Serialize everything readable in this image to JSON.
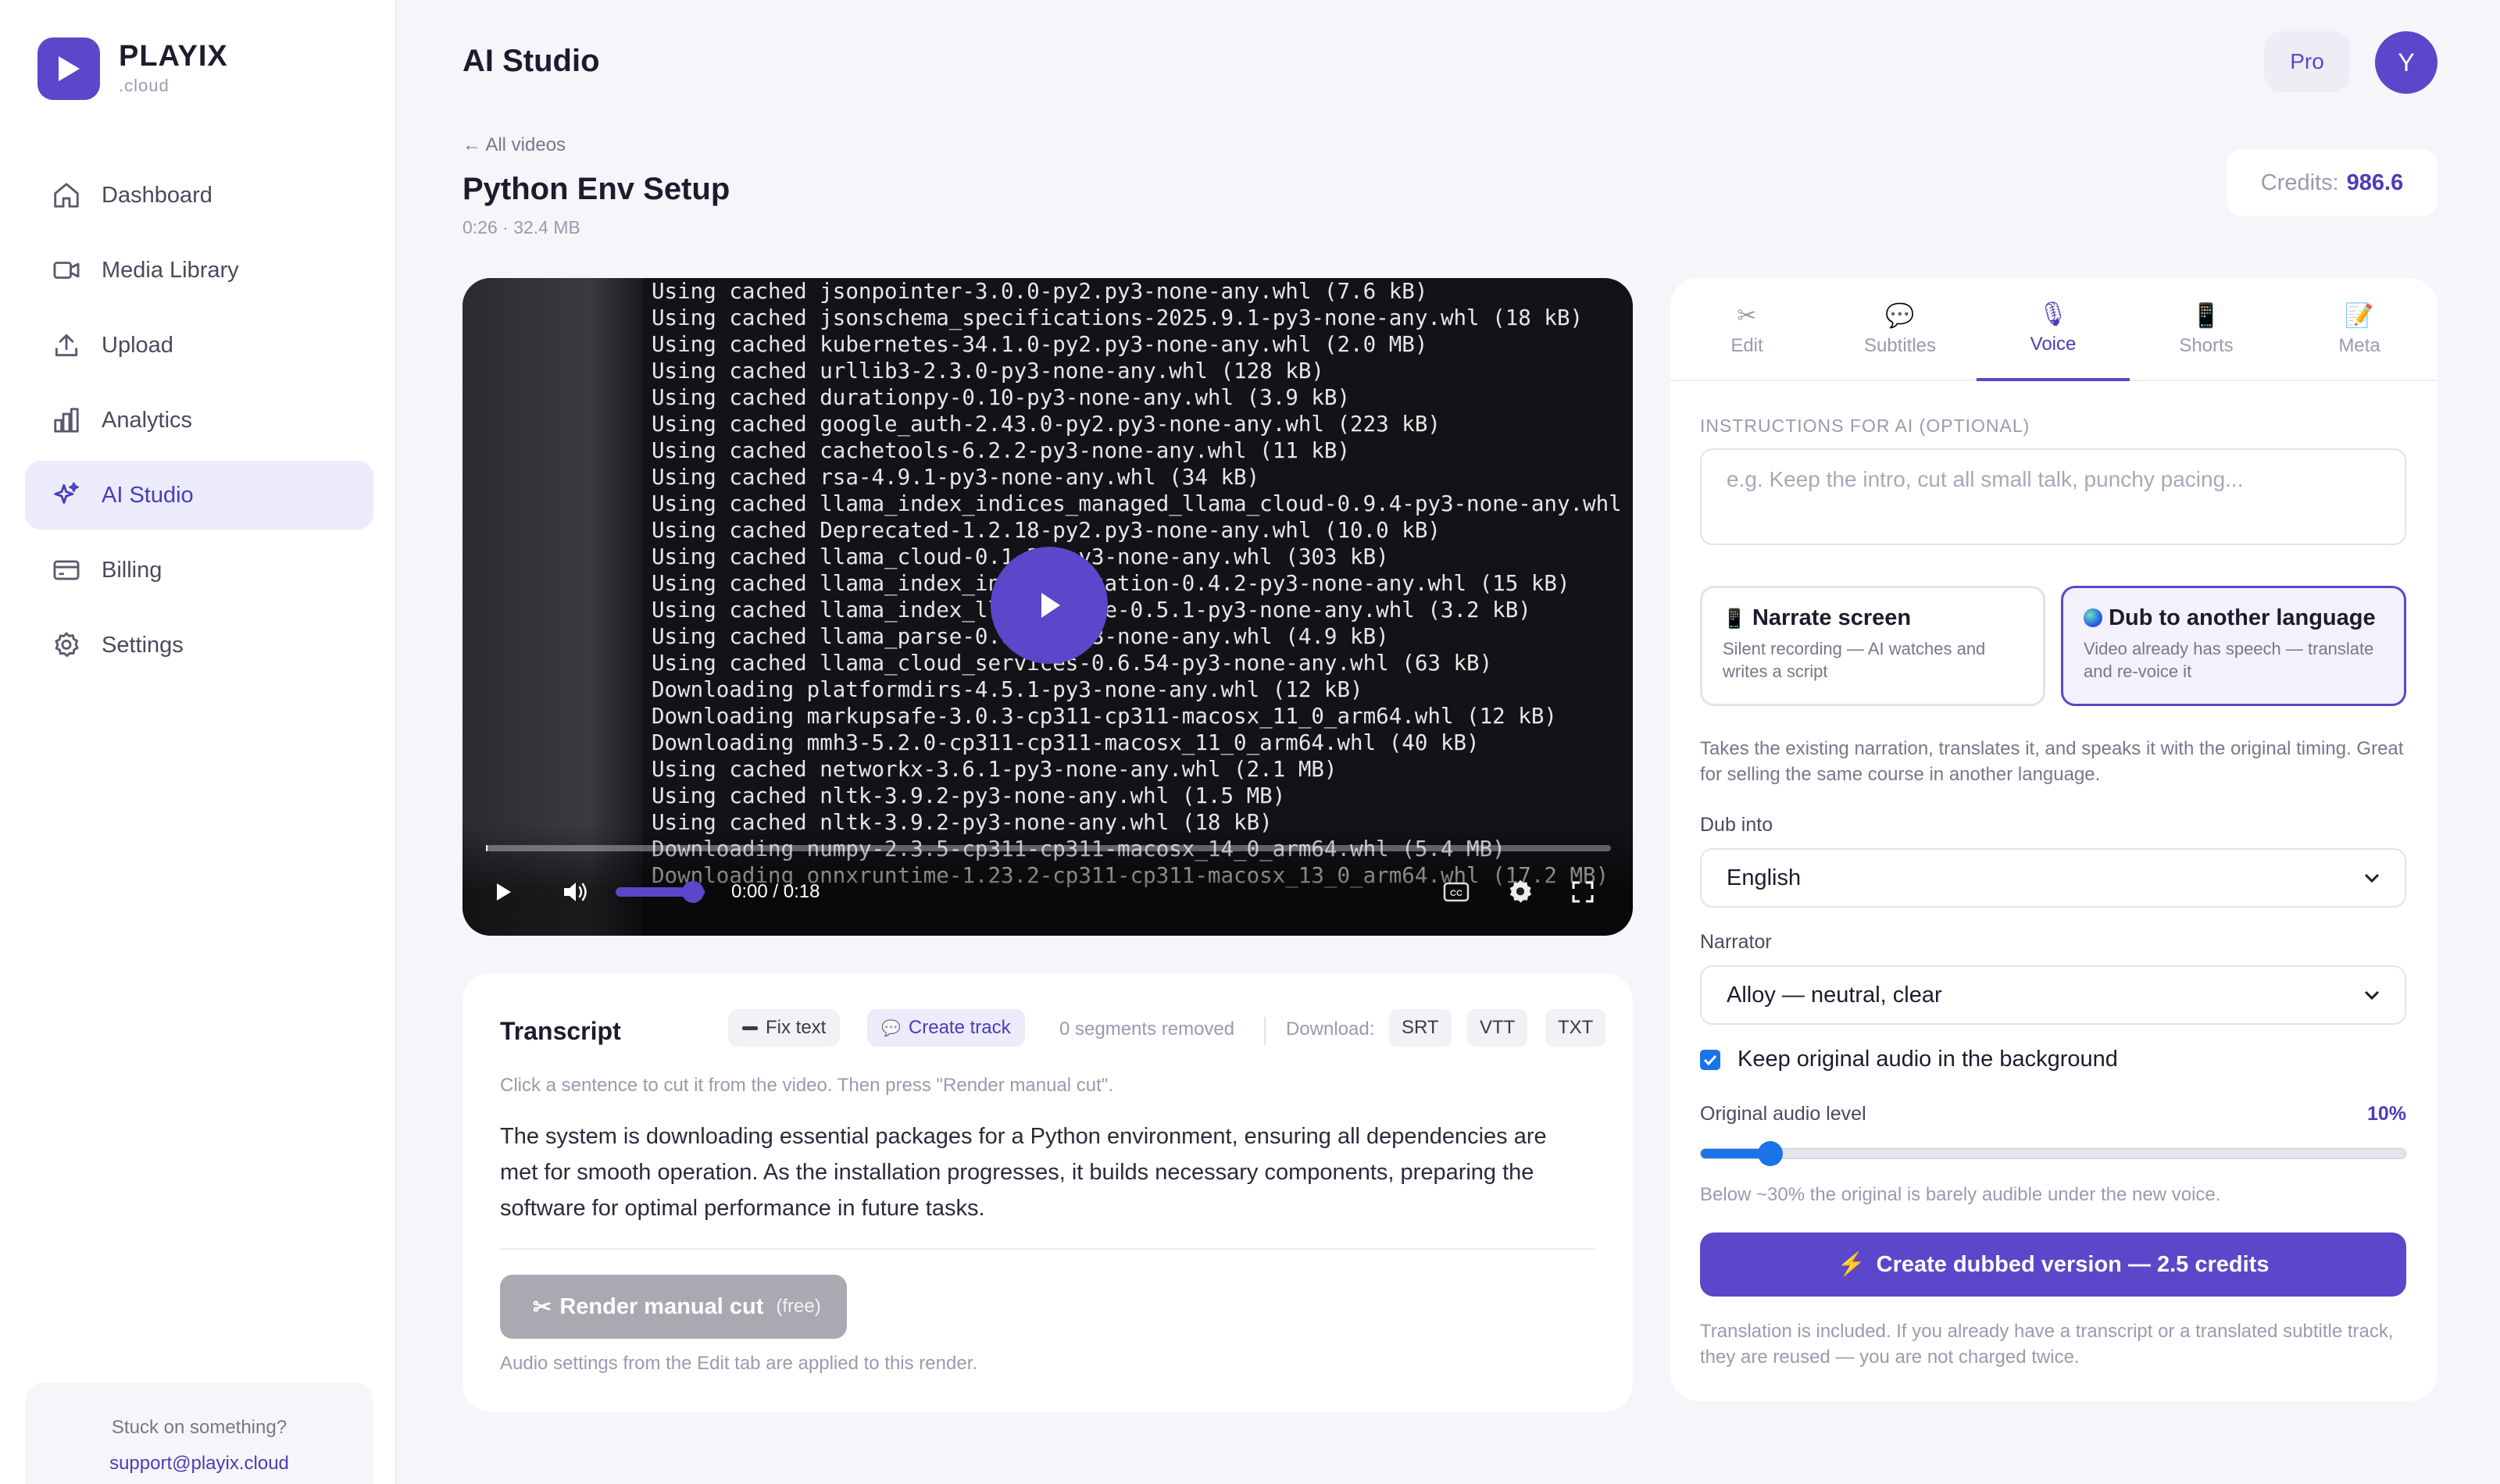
{
  "brand": {
    "name": "PLAYIX",
    "sub": ".cloud",
    "accent": "#5b47c9"
  },
  "sidebar": {
    "items": [
      {
        "label": "Dashboard",
        "icon": "home-icon"
      },
      {
        "label": "Media Library",
        "icon": "video-camera-icon"
      },
      {
        "label": "Upload",
        "icon": "upload-icon"
      },
      {
        "label": "Analytics",
        "icon": "bar-chart-icon"
      },
      {
        "label": "AI Studio",
        "icon": "sparkles-icon",
        "active": true
      },
      {
        "label": "Billing",
        "icon": "credit-card-icon"
      },
      {
        "label": "Settings",
        "icon": "gear-icon"
      }
    ],
    "support": {
      "question": "Stuck on something?",
      "email": "support@playix.cloud"
    }
  },
  "header": {
    "title": "AI Studio",
    "plan": "Pro",
    "avatar_initial": "Y"
  },
  "video": {
    "back": "← All videos",
    "title": "Python Env Setup",
    "meta": "0:26 · 32.4 MB",
    "time": "0:00 / 0:18",
    "progress": 0,
    "volume": 0.8,
    "terminal_lines": [
      "Using cached jsonpointer-3.0.0-py2.py3-none-any.whl (7.6 kB)",
      "Using cached jsonschema_specifications-2025.9.1-py3-none-any.whl (18 kB)",
      "Using cached kubernetes-34.1.0-py2.py3-none-any.whl (2.0 MB)",
      "Using cached urllib3-2.3.0-py3-none-any.whl (128 kB)",
      "Using cached durationpy-0.10-py3-none-any.whl (3.9 kB)",
      "Using cached google_auth-2.43.0-py2.py3-none-any.whl (223 kB)",
      "Using cached cachetools-6.2.2-py3-none-any.whl (11 kB)",
      "Using cached rsa-4.9.1-py3-none-any.whl (34 kB)",
      "Using cached llama_index_indices_managed_llama_cloud-0.9.4-py3-none-any.whl",
      "Using cached Deprecated-1.2.18-py2.py3-none-any.whl (10.0 kB)",
      "Using cached llama_cloud-0.1.35-py3-none-any.whl (303 kB)",
      "Using cached llama_index_instrumentation-0.4.2-py3-none-any.whl (15 kB)",
      "Using cached llama_index_llama_parse-0.5.1-py3-none-any.whl (3.2 kB)",
      "Using cached llama_parse-0.6.54-py3-none-any.whl (4.9 kB)",
      "Using cached llama_cloud_services-0.6.54-py3-none-any.whl (63 kB)",
      "Downloading platformdirs-4.5.1-py3-none-any.whl (12 kB)",
      "Downloading markupsafe-3.0.3-cp311-cp311-macosx_11_0_arm64.whl (12 kB)",
      "Downloading mmh3-5.2.0-cp311-cp311-macosx_11_0_arm64.whl (40 kB)",
      "Using cached networkx-3.6.1-py3-none-any.whl (2.1 MB)",
      "Using cached nltk-3.9.2-py3-none-any.whl (1.5 MB)",
      "Using cached nltk-3.9.2-py3-none-any.whl (18 kB)",
      "Downloading numpy-2.3.5-cp311-cp311-macosx_14_0_arm64.whl (5.4 MB)",
      "Downloading onnxruntime-1.23.2-cp311-cp311-macosx_13_0_arm64.whl (17.2 MB)"
    ]
  },
  "credits": {
    "label": "Credits:",
    "value": "986.6"
  },
  "transcript": {
    "title": "Transcript",
    "fix_text": "Fix text",
    "create_track": "Create track",
    "segments_removed": "0 segments removed",
    "download_label": "Download:",
    "formats": [
      "SRT",
      "VTT",
      "TXT"
    ],
    "hint": "Click a sentence to cut it from the video. Then press \"Render manual cut\".",
    "body": " The system is downloading essential packages for a Python environment, ensuring all dependencies are met for smooth operation.   As the installation progresses, it builds necessary components, preparing the software for optimal performance in future tasks.",
    "render_label": "Render manual cut",
    "render_tag": "(free)",
    "render_note": "Audio settings from the Edit tab are applied to this render."
  },
  "panel": {
    "tabs": [
      {
        "label": "Edit",
        "icon": "scissors-icon"
      },
      {
        "label": "Subtitles",
        "icon": "speech-bubble-icon"
      },
      {
        "label": "Voice",
        "icon": "microphone-icon",
        "active": true
      },
      {
        "label": "Shorts",
        "icon": "phone-icon"
      },
      {
        "label": "Meta",
        "icon": "document-icon"
      }
    ],
    "instructions_label": "INSTRUCTIONS FOR AI (OPTIONAL)",
    "instructions_placeholder": "e.g. Keep the intro, cut all small talk, punchy pacing...",
    "options": [
      {
        "title": "Narrate screen",
        "desc": "Silent recording — AI watches and writes a script",
        "icon": "phone-icon"
      },
      {
        "title": "Dub to another language",
        "desc": "Video already has speech — translate and re-voice it",
        "icon": "globe-icon",
        "selected": true
      }
    ],
    "description": "Takes the existing narration, translates it, and speaks it with the original timing. Great for selling the same course in another language.",
    "dub_label": "Dub into",
    "dub_value": "English",
    "narrator_label": "Narrator",
    "narrator_value": "Alloy — neutral, clear",
    "keep_audio_label": "Keep original audio in the background",
    "keep_audio_checked": true,
    "level_label": "Original audio level",
    "level_value": "10%",
    "level_fraction": 0.1,
    "level_note": "Below ~30% the original is barely audible under the new voice.",
    "cta_label": "Create dubbed version — 2.5 credits",
    "cta_note": "Translation is included. If you already have a transcript or a translated subtitle track, they are reused — you are not charged twice."
  }
}
